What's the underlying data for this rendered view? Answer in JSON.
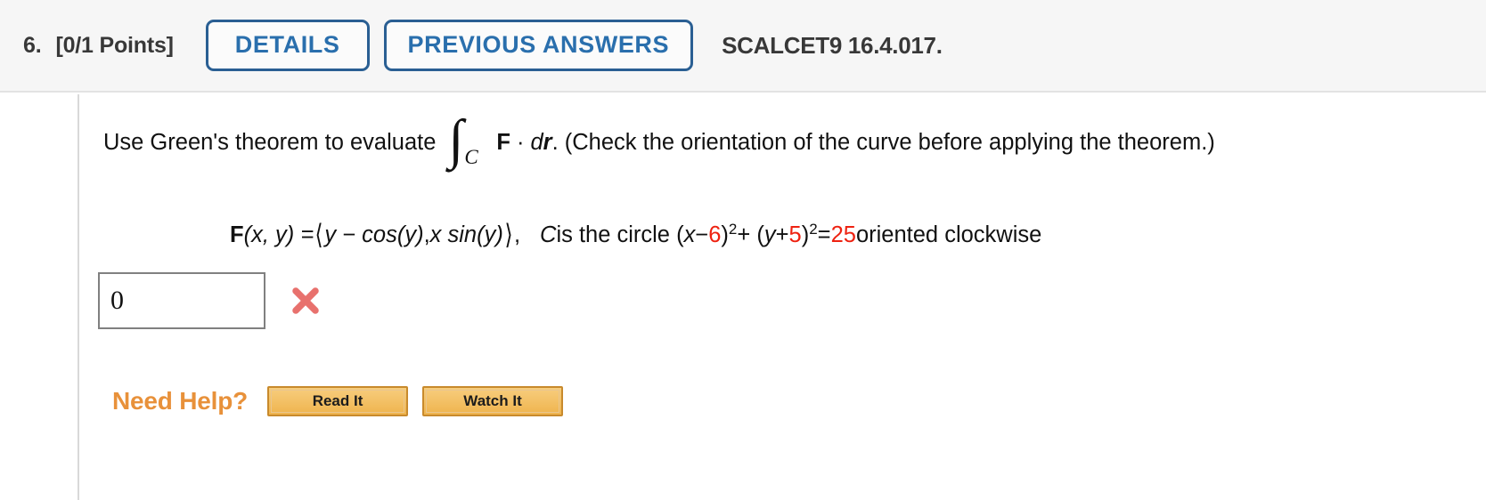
{
  "header": {
    "question_number": "6.",
    "points": "[0/1 Points]",
    "details_label": "DETAILS",
    "previous_answers_label": "PREVIOUS ANSWERS",
    "reference": "SCALCET9 16.4.017.",
    "accent_color": "#2a5f93",
    "background_color": "#f6f6f6"
  },
  "problem": {
    "prompt_before_integral": "Use Green's theorem to evaluate",
    "integral_symbol": "∫",
    "integral_subscript": "C",
    "integrand_F": "F",
    "integrand_dot": "·",
    "integrand_d": "d",
    "integrand_r": "r",
    "prompt_after_integral": ". (Check the orientation of the curve before applying the theorem.)"
  },
  "math": {
    "field_F": "F",
    "field_args": "(x, y) = ",
    "angle_open": "⟨",
    "component_1": "y − cos(y)",
    "comma": ", ",
    "component_2": "x sin(y)",
    "angle_close": "⟩",
    "after_vector": ",",
    "curve_label": "C",
    "curve_text_1": " is the circle (",
    "curve_x": "x",
    "curve_minus": " − ",
    "center_x": "6",
    "curve_close_1": ")",
    "exp_1": "2",
    "curve_plus": " + (",
    "curve_y": "y",
    "curve_plus_2": " + ",
    "center_y": "5",
    "curve_close_2": ")",
    "exp_2": "2",
    "curve_equals": " = ",
    "radius_squared": "25",
    "orientation": " oriented clockwise",
    "highlight_color": "#ee2211"
  },
  "answer": {
    "value": "0",
    "placeholder": "",
    "status_icon": "incorrect-x-icon",
    "status_color": "#e8716d"
  },
  "help": {
    "label": "Need Help?",
    "read_it_label": "Read It",
    "watch_it_label": "Watch It",
    "label_color": "#e8913a"
  }
}
